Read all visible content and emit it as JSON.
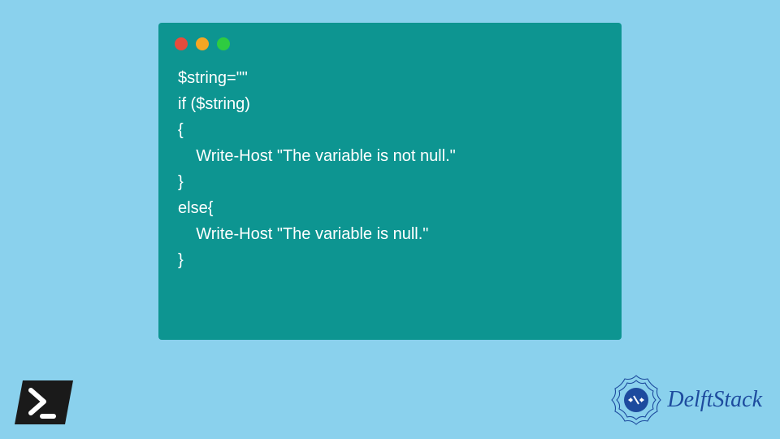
{
  "code": {
    "lines": [
      "$string=\"\"",
      "if ($string)",
      "{",
      "    Write-Host \"The variable is not null.\"",
      "}",
      "else{",
      "    Write-Host \"The variable is null.\"",
      "}"
    ]
  },
  "logo": {
    "text": "DelftStack"
  }
}
